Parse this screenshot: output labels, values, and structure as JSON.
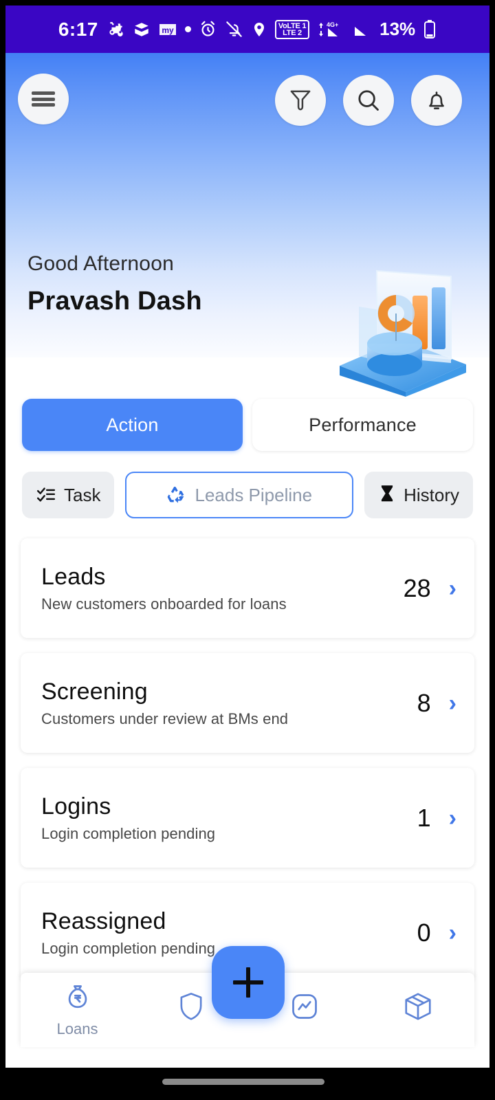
{
  "status_bar": {
    "time": "6:17",
    "battery_percent": "13%",
    "network_badge_top": "VoLTE 1",
    "network_badge_bottom": "LTE 2",
    "network_type": "4G+",
    "icons": [
      "scooter-icon",
      "app-icon",
      "bookmyshow-icon",
      "dot-icon",
      "alarm-icon",
      "bell-muted-icon",
      "location-icon",
      "volte-icon",
      "signal-icon",
      "signal-2-icon",
      "battery-icon"
    ],
    "background_color": "#3a06c4"
  },
  "header": {
    "menu_icon": "hamburger-menu-icon",
    "filter_icon": "filter-icon",
    "search_icon": "search-icon",
    "notification_icon": "bell-icon",
    "greeting": "Good Afternoon",
    "user_name": "Pravash Dash",
    "illustration": "analytics-dashboard-3d-illustration",
    "gradient_top": "#4380f5",
    "gradient_bottom": "#fbfcff"
  },
  "segment_tabs": [
    {
      "label": "Action",
      "active": true
    },
    {
      "label": "Performance",
      "active": false
    }
  ],
  "chips": [
    {
      "label": "Task",
      "icon": "checklist-icon",
      "style": "muted"
    },
    {
      "label": "Leads Pipeline",
      "icon": "recycle-icon",
      "style": "outline"
    },
    {
      "label": "History",
      "icon": "hourglass-icon",
      "style": "muted"
    }
  ],
  "cards": [
    {
      "title": "Leads",
      "subtitle": "New customers onboarded for loans",
      "count": "28",
      "chevron": "›"
    },
    {
      "title": "Screening",
      "subtitle": "Customers under review at BMs end",
      "count": "8",
      "chevron": "›"
    },
    {
      "title": "Logins",
      "subtitle": "Login completion pending",
      "count": "1",
      "chevron": "›"
    },
    {
      "title": "Reassigned",
      "subtitle": "Login completion pending",
      "count": "0",
      "chevron": "›"
    }
  ],
  "fab": {
    "icon": "plus-icon",
    "color": "#4a86f7"
  },
  "bottom_nav": [
    {
      "label": "Loans",
      "icon": "money-bag-rupee-icon",
      "active": true
    },
    {
      "label": "",
      "icon": "shield-icon",
      "active": false
    },
    {
      "label": "",
      "icon": "trend-chart-icon",
      "active": false
    },
    {
      "label": "",
      "icon": "package-box-icon",
      "active": false
    }
  ],
  "accent_color": "#4a86f7",
  "chevron_color": "#3f76e8"
}
